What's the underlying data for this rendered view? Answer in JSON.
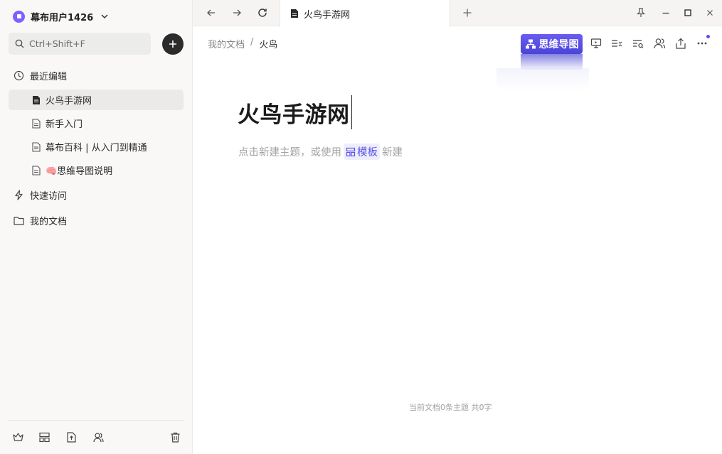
{
  "sidebar": {
    "user_name": "幕布用户1426",
    "search_placeholder": "Ctrl+Shift+F",
    "recent_label": "最近编辑",
    "recent_items": [
      {
        "label": "火鸟手游网",
        "active": true
      },
      {
        "label": "新手入门",
        "active": false
      },
      {
        "label": "幕布百科 | 从入门到精通",
        "active": false
      },
      {
        "label": "🧠思维导图说明",
        "active": false
      }
    ],
    "quick_access_label": "快速访问",
    "my_docs_label": "我的文档"
  },
  "tab": {
    "title": "火鸟手游网"
  },
  "breadcrumb": {
    "root": "我的文档",
    "separator": "/",
    "current": "火鸟"
  },
  "toolbar": {
    "mindmap_label": "思维导图"
  },
  "document": {
    "title": "火鸟手游网",
    "hint_prefix": "点击新建主题，或使用",
    "template_label": "模板",
    "hint_suffix": "新建"
  },
  "footer": {
    "stats": "当前文档0条主题 共0字"
  },
  "colors": {
    "accent": "#5b52e6",
    "avatar": "#7b61ff"
  }
}
